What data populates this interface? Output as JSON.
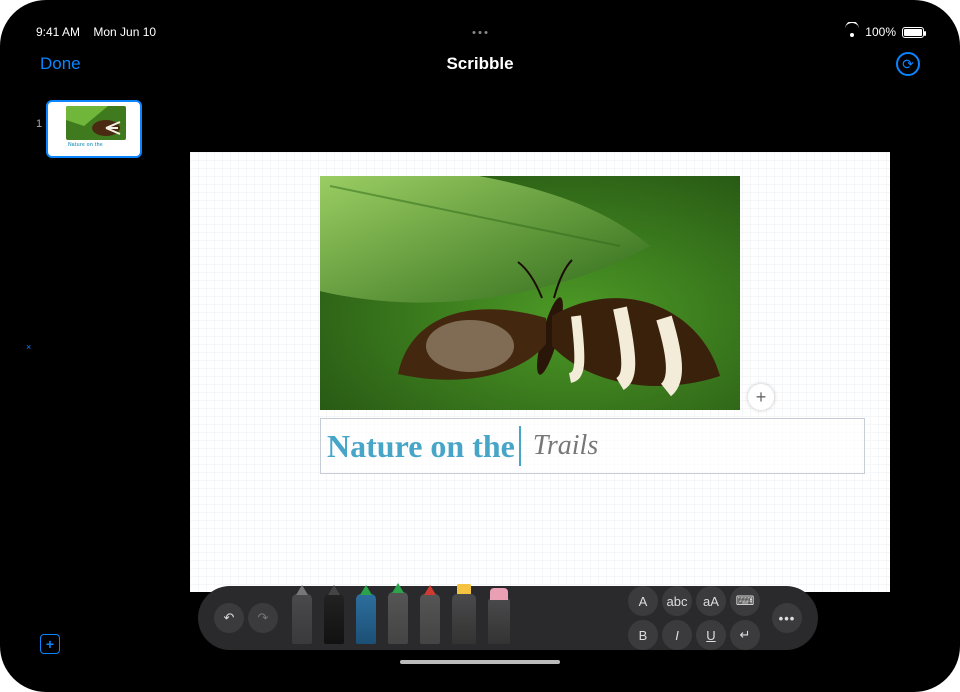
{
  "status": {
    "time": "9:41 AM",
    "date": "Mon Jun 10",
    "battery_pct": "100%"
  },
  "header": {
    "done_label": "Done",
    "title": "Scribble"
  },
  "rail": {
    "slide_number": "1",
    "thumb_caption": "Nature on the",
    "add_slide_glyph": "+"
  },
  "canvas": {
    "typed_text": "Nature on the",
    "handwritten_text": "Trails",
    "add_button_glyph": "+"
  },
  "toolbar": {
    "undo": "↶",
    "redo": "↷",
    "aa": "A",
    "abc": "abc",
    "textsize": "aA",
    "keyboard": "⌨",
    "bold": "B",
    "italic": "I",
    "underline": "U",
    "return": "↵",
    "more": "•••"
  },
  "icons": {
    "reset": "⟳"
  }
}
